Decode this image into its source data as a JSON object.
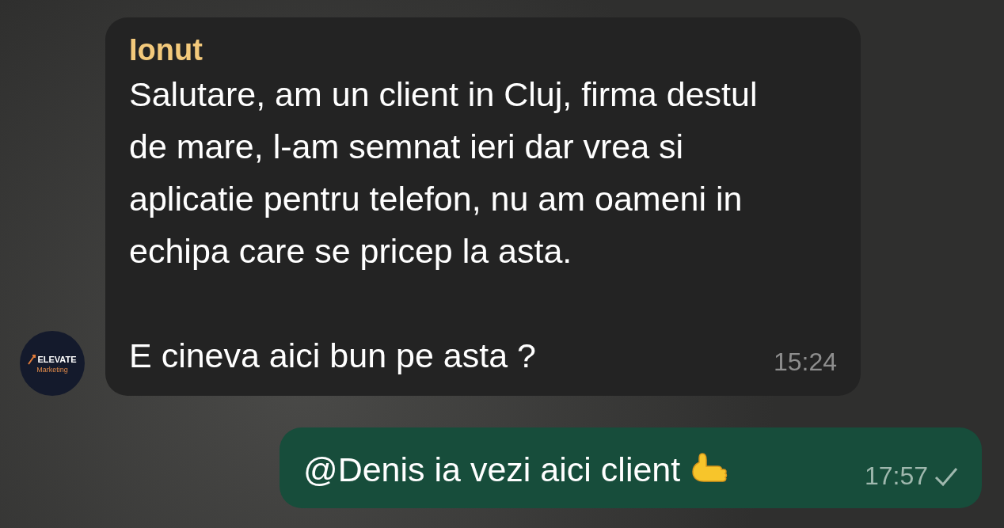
{
  "messages": [
    {
      "kind": "incoming",
      "avatar": {
        "title": "ELEVATE",
        "subtitle": "Marketing"
      },
      "sender": "Ionut",
      "paragraphs": [
        "Salutare, am un client in Cluj, firma destul de mare, l-am semnat ieri dar vrea si aplicatie pentru telefon, nu am oameni in echipa care se pricep la asta.",
        "E cineva aici bun pe asta ?"
      ],
      "time": "15:24"
    },
    {
      "kind": "outgoing",
      "paragraphs": [
        "@Denis ia vezi aici client"
      ],
      "time": "17:57",
      "read": false
    }
  ]
}
